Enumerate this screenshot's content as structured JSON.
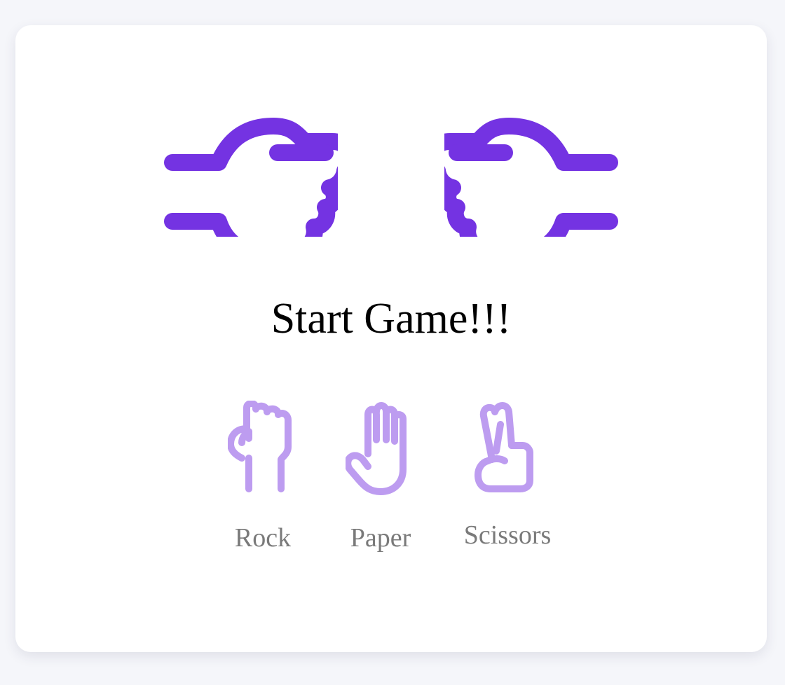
{
  "colors": {
    "hand_primary": "#7433e2",
    "choice_icon": "#bd9cf0",
    "label": "#7a7a7a",
    "background": "#f5f6fa",
    "card": "#ffffff"
  },
  "arena": {
    "player_hand_icon": "fist-pointing-right-icon",
    "computer_hand_icon": "fist-pointing-left-icon"
  },
  "status_text": "Start Game!!!",
  "choices": [
    {
      "id": "rock",
      "label": "Rock",
      "icon": "rock-fist-icon"
    },
    {
      "id": "paper",
      "label": "Paper",
      "icon": "paper-hand-icon"
    },
    {
      "id": "scissors",
      "label": "Scissors",
      "icon": "scissors-hand-icon"
    }
  ]
}
